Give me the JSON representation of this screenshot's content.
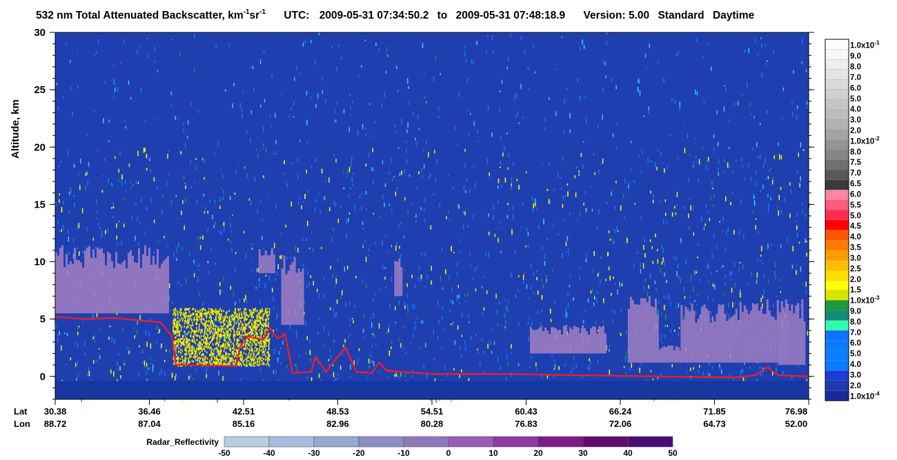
{
  "title": {
    "product": "532 nm Total Attenuated Backscatter, km",
    "unit_sup1": "-1",
    "unit_mid": " sr",
    "unit_sup2": "-1",
    "utc_label": "UTC:",
    "utc_start": "2009-05-31 07:34:50.2",
    "utc_to": "to",
    "utc_end": "2009-05-31 07:48:18.9",
    "version": "Version: 5.00",
    "mode": "Standard",
    "time_of_day": "Daytime"
  },
  "chart_data": {
    "type": "heatmap",
    "ylabel": "Altitude, km",
    "ylim": [
      -2,
      30
    ],
    "yticks": [
      "30",
      "25",
      "20",
      "15",
      "10",
      "5",
      "0"
    ],
    "x_rows": {
      "lat_label": "Lat",
      "lon_label": "Lon",
      "lat": [
        "30.38",
        "36.46",
        "42.51",
        "48.53",
        "54.51",
        "60.43",
        "66.24",
        "71.85",
        "76.98"
      ],
      "lon": [
        "88.72",
        "87.04",
        "85.16",
        "82.96",
        "80.28",
        "76.83",
        "72.06",
        "64.73",
        "52.00"
      ]
    },
    "colorbar": {
      "labels": [
        "1.0x10-1",
        "9.0",
        "8.0",
        "7.0",
        "6.0",
        "5.0",
        "4.0",
        "3.0",
        "2.0",
        "1.0x10-2",
        "8.0",
        "7.5",
        "7.0",
        "6.5",
        "6.0",
        "5.5",
        "5.0",
        "4.5",
        "4.0",
        "3.5",
        "3.0",
        "2.5",
        "2.0",
        "1.5",
        "1.0x10-3",
        "9.0",
        "8.0",
        "7.0",
        "6.0",
        "5.0",
        "4.0",
        "3.0",
        "2.0",
        "1.0x10-4"
      ],
      "colors": [
        "#ffffff",
        "#f7f7f7",
        "#eeeeee",
        "#e4e4e4",
        "#dadada",
        "#d0d0d0",
        "#c6c6c6",
        "#bcbcbc",
        "#b2b2b2",
        "#a4a4a4",
        "#959595",
        "#858585",
        "#707070",
        "#585858",
        "#3a3a3a",
        "#ff86a0",
        "#ff5a7a",
        "#ff2c50",
        "#ff0000",
        "#ff5500",
        "#ff7a00",
        "#ff9a00",
        "#ffbf00",
        "#ffdd00",
        "#ffff00",
        "#d6e600",
        "#1a9a3a",
        "#138b79",
        "#30ffb0",
        "#0a73ff",
        "#0a7dff",
        "#0a7dff",
        "#0a7dff",
        "#1e3ad6",
        "#1e3ab0",
        "#1a2a9a"
      ]
    },
    "radar_bar": {
      "label": "Radar_Reflectivity",
      "ticks": [
        "-50",
        "-40",
        "-30",
        "-20",
        "-10",
        "0",
        "10",
        "20",
        "30",
        "40",
        "50"
      ],
      "colors": [
        "#b9cde2",
        "#a6bedb",
        "#92a9d0",
        "#8a8fc6",
        "#8e78bb",
        "#9a5db4",
        "#8e39a4",
        "#7d1a8a",
        "#620a6e",
        "#4a0a78",
        "#3a0a8c"
      ]
    },
    "features": {
      "surface_ribbon_color": "#ff1a1a",
      "cloud_color": "#9f7ec2"
    }
  }
}
